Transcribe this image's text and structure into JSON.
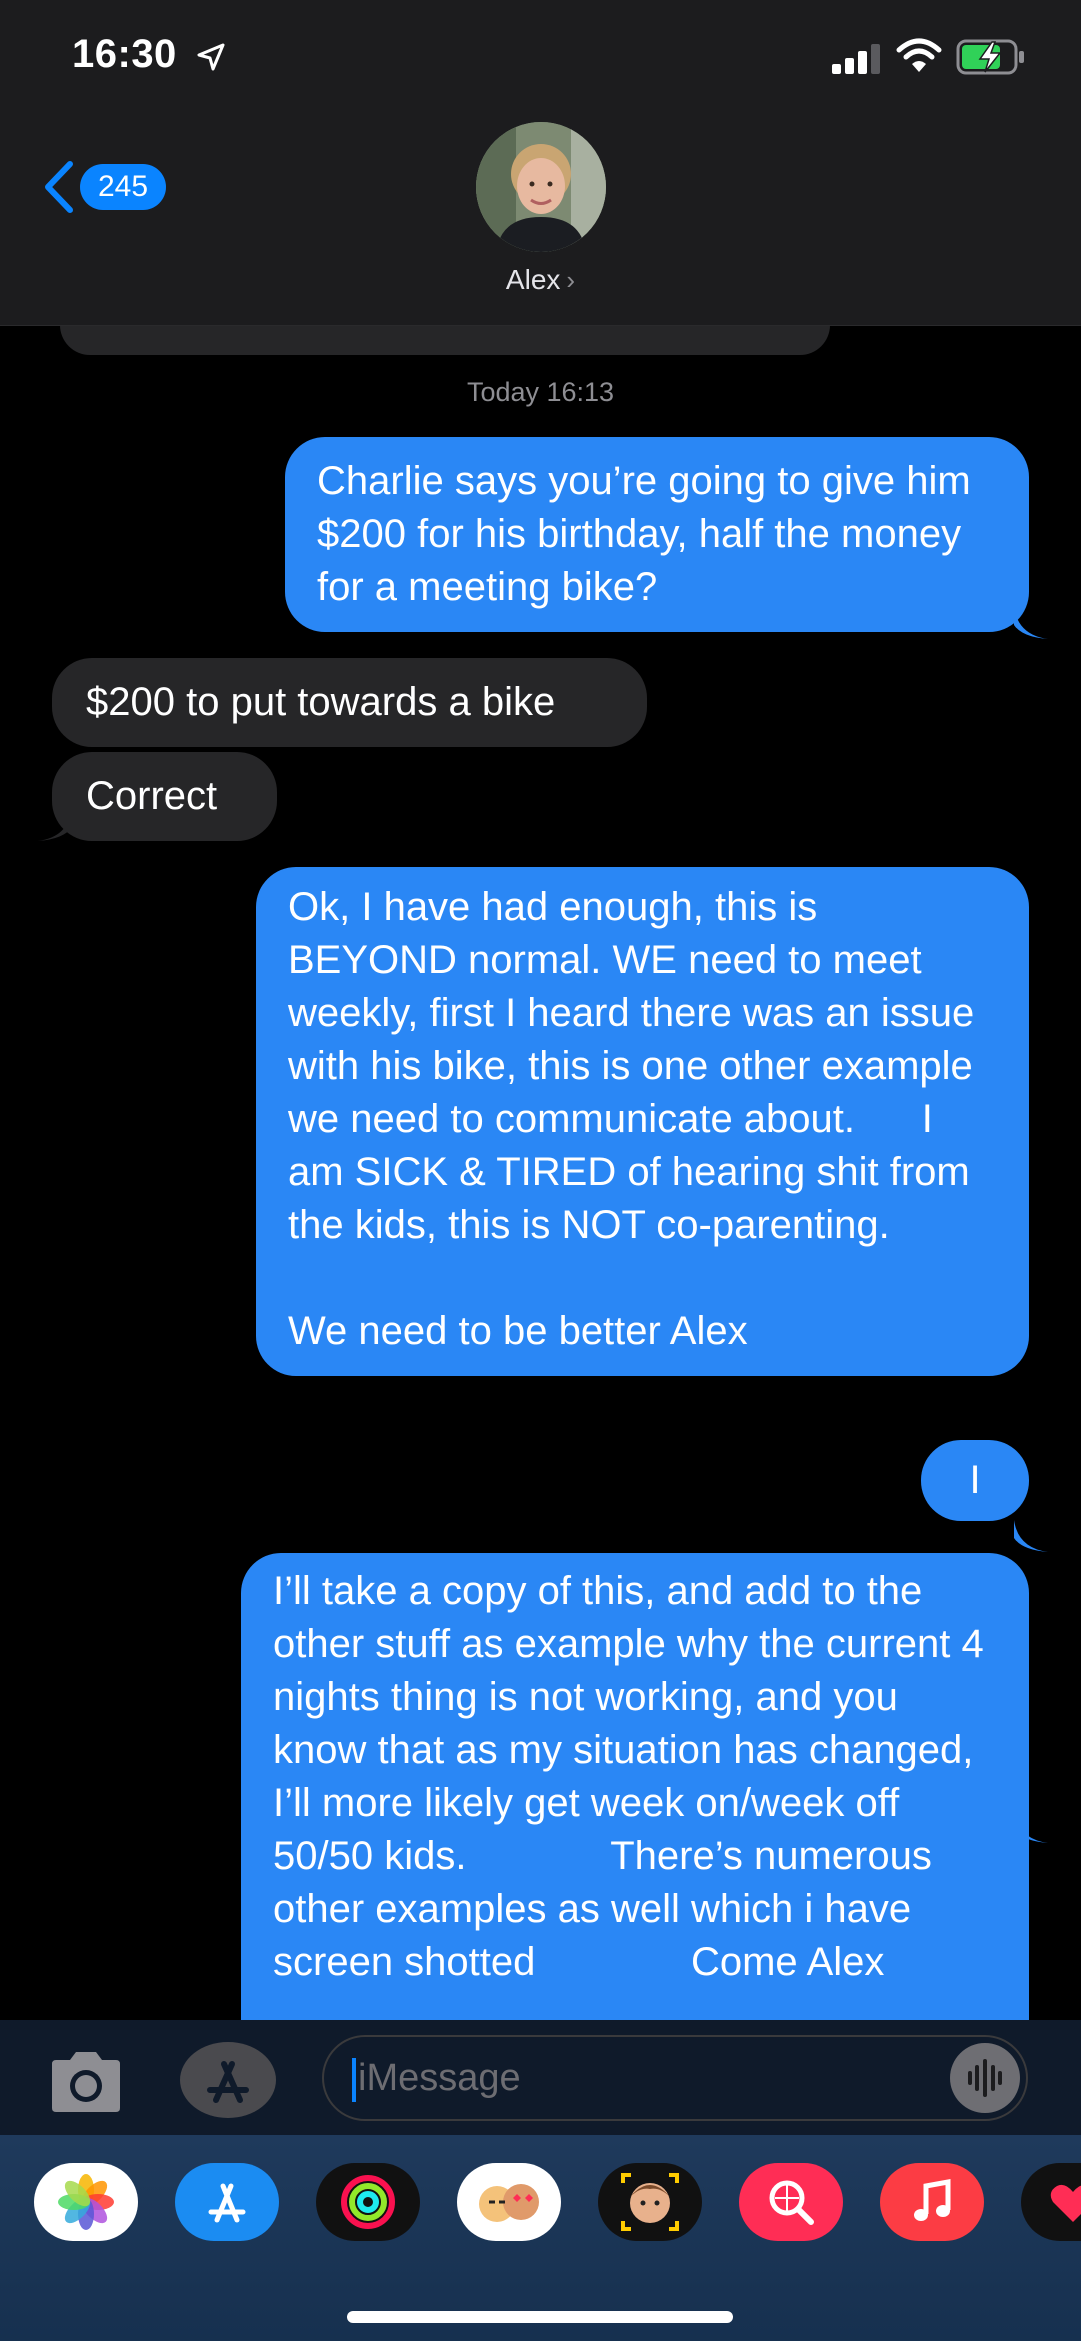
{
  "status_bar": {
    "time": "16:30",
    "icons": [
      "location-arrow-icon",
      "cellular-signal-icon",
      "wifi-icon",
      "battery-charging-icon"
    ]
  },
  "header": {
    "back_count": "245",
    "contact_name": "Alex",
    "name_chevron": "›"
  },
  "thread": {
    "timestamp": "Today 16:13",
    "messages": [
      {
        "from": "me",
        "text": "Charlie says you’re going to give him $200 for his birthday, half the money for a meeting bike?"
      },
      {
        "from": "them",
        "text": "$200 to put towards a bike"
      },
      {
        "from": "them",
        "text": "Correct"
      },
      {
        "from": "me",
        "text": "Ok, I have had enough, this is BEYOND normal. WE need to meet weekly, first I heard there was an issue with his bike, this is one other example we need to communicate about.      I am SICK & TIRED of hearing shit from the kids, this is NOT co-parenting.\n\nWe need to be better Alex"
      },
      {
        "from": "me",
        "text": "I"
      },
      {
        "from": "me",
        "text": "I’ll take a copy of this, and add to the other stuff as example why the current 4 nights thing is not working, and you know that as my situation has changed, I’ll more likely get week on/week off 50/50 kids.             There’s numerous other examples as well which i have screen shotted              Come Alex"
      }
    ]
  },
  "input": {
    "placeholder": "iMessage"
  },
  "app_drawer": {
    "apps": [
      "photos-icon",
      "app-store-icon",
      "activity-icon",
      "memoji-stickers-icon",
      "animoji-icon",
      "images-search-icon",
      "music-icon",
      "digital-touch-icon"
    ]
  },
  "colors": {
    "outgoing_bubble": "#2a87f5",
    "incoming_bubble": "#262628",
    "accent": "#0a84ff",
    "background": "#000000"
  }
}
